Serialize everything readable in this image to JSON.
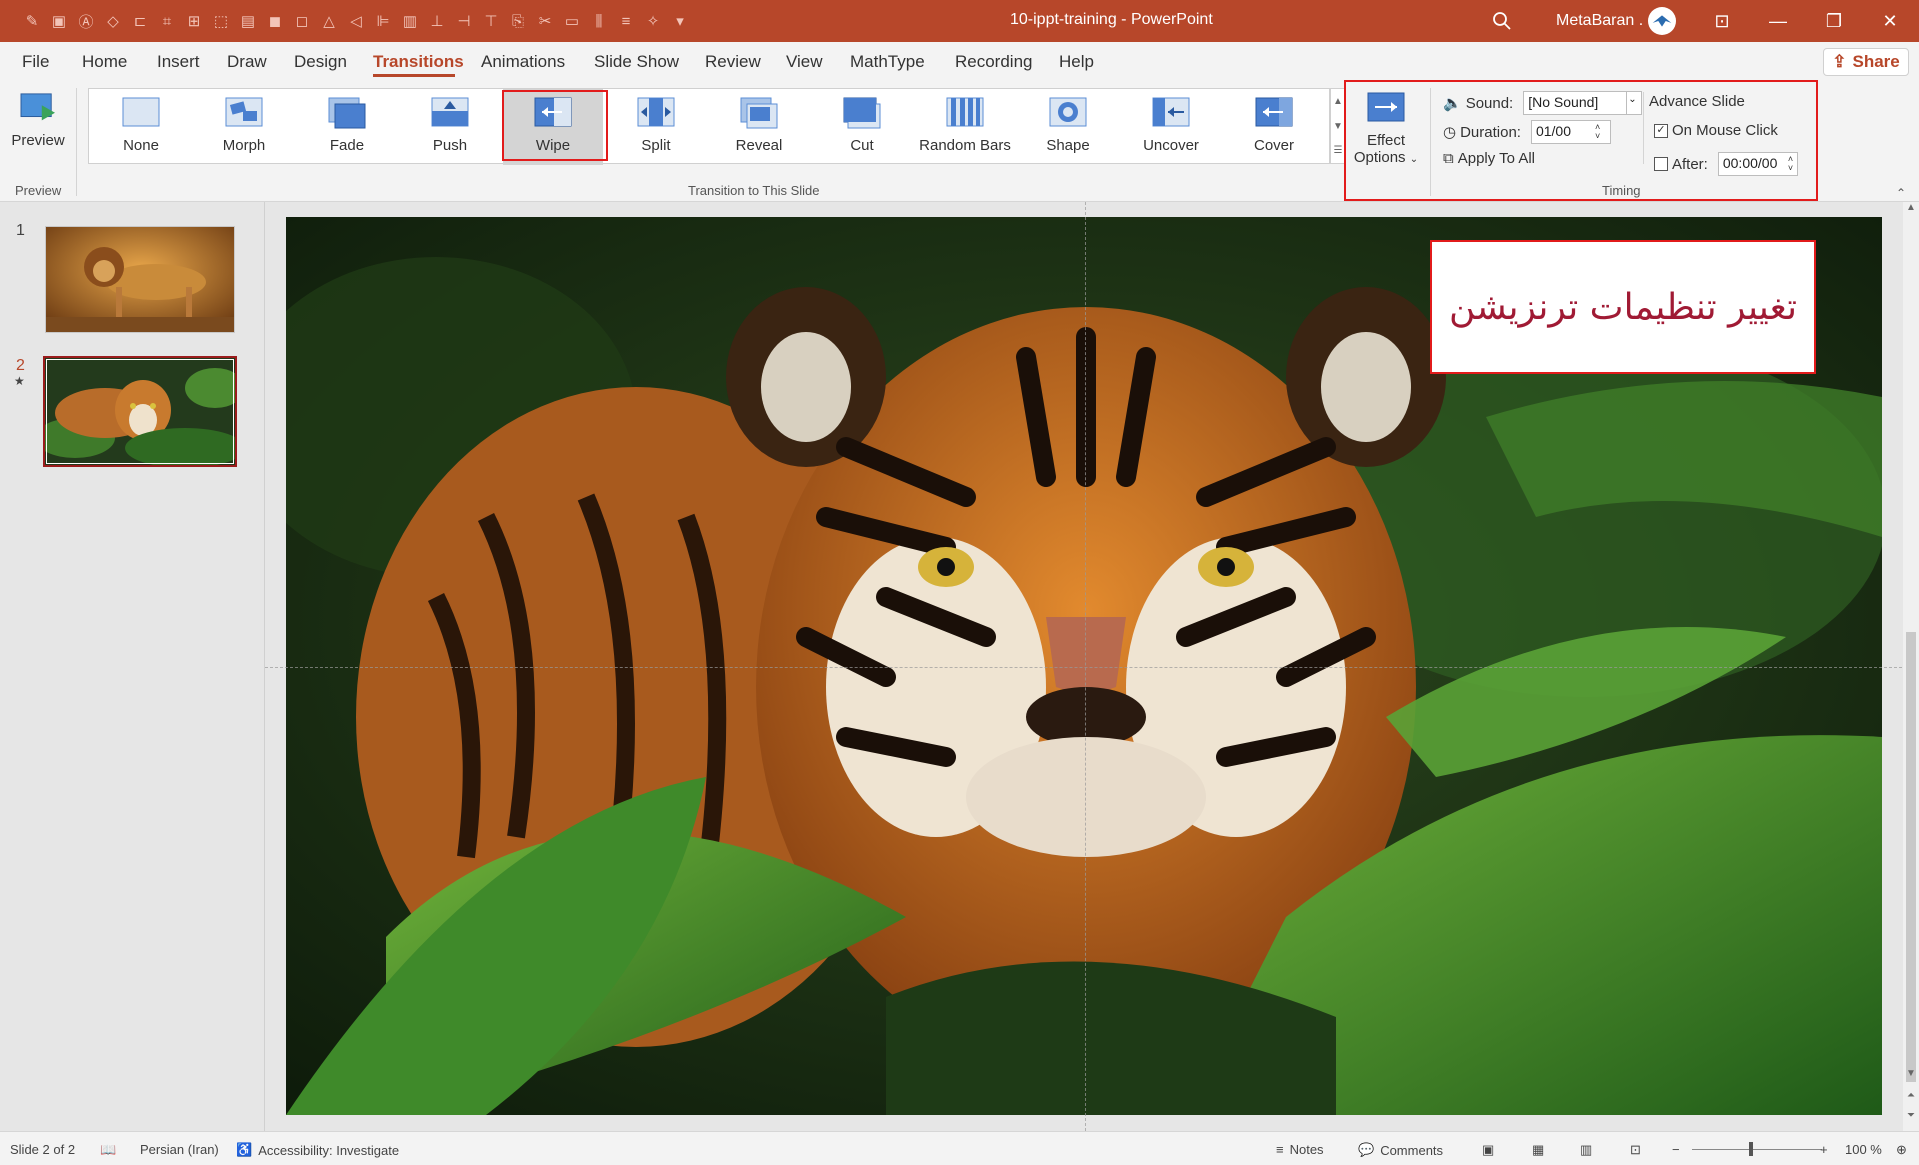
{
  "app": {
    "title": "10-ippt-training  -  PowerPoint",
    "user": "MetaBaran ."
  },
  "menu": {
    "tabs": [
      "File",
      "Home",
      "Insert",
      "Draw",
      "Design",
      "Transitions",
      "Animations",
      "Slide Show",
      "Review",
      "View",
      "MathType",
      "Recording",
      "Help"
    ],
    "active": "Transitions",
    "share": "Share"
  },
  "ribbon": {
    "preview_label": "Preview",
    "preview_group": "Preview",
    "gallery_group": "Transition to This Slide",
    "gallery": [
      "None",
      "Morph",
      "Fade",
      "Push",
      "Wipe",
      "Split",
      "Reveal",
      "Cut",
      "Random Bars",
      "Shape",
      "Uncover",
      "Cover"
    ],
    "selected": "Wipe",
    "effect_options": [
      "Effect",
      "Options"
    ],
    "timing": {
      "sound_label": "Sound:",
      "sound_value": "[No Sound]",
      "duration_label": "Duration:",
      "duration_value": "01/00",
      "apply_all": "Apply To All",
      "advance_title": "Advance Slide",
      "on_click_label": "On Mouse Click",
      "on_click_checked": true,
      "after_label": "After:",
      "after_checked": false,
      "after_value": "00:00/00",
      "group": "Timing"
    }
  },
  "slides": {
    "numbers": [
      "1",
      "2"
    ],
    "selected": 2
  },
  "callout_text": "تغییر تنظیمات ترنزیشن",
  "status": {
    "slide": "Slide 2 of 2",
    "language": "Persian (Iran)",
    "accessibility": "Accessibility: Investigate",
    "notes": "Notes",
    "comments": "Comments",
    "zoom": "100 %"
  },
  "colors": {
    "accent": "#b7472a",
    "highlight": "#e21b1b",
    "callout_text": "#a01a34"
  }
}
